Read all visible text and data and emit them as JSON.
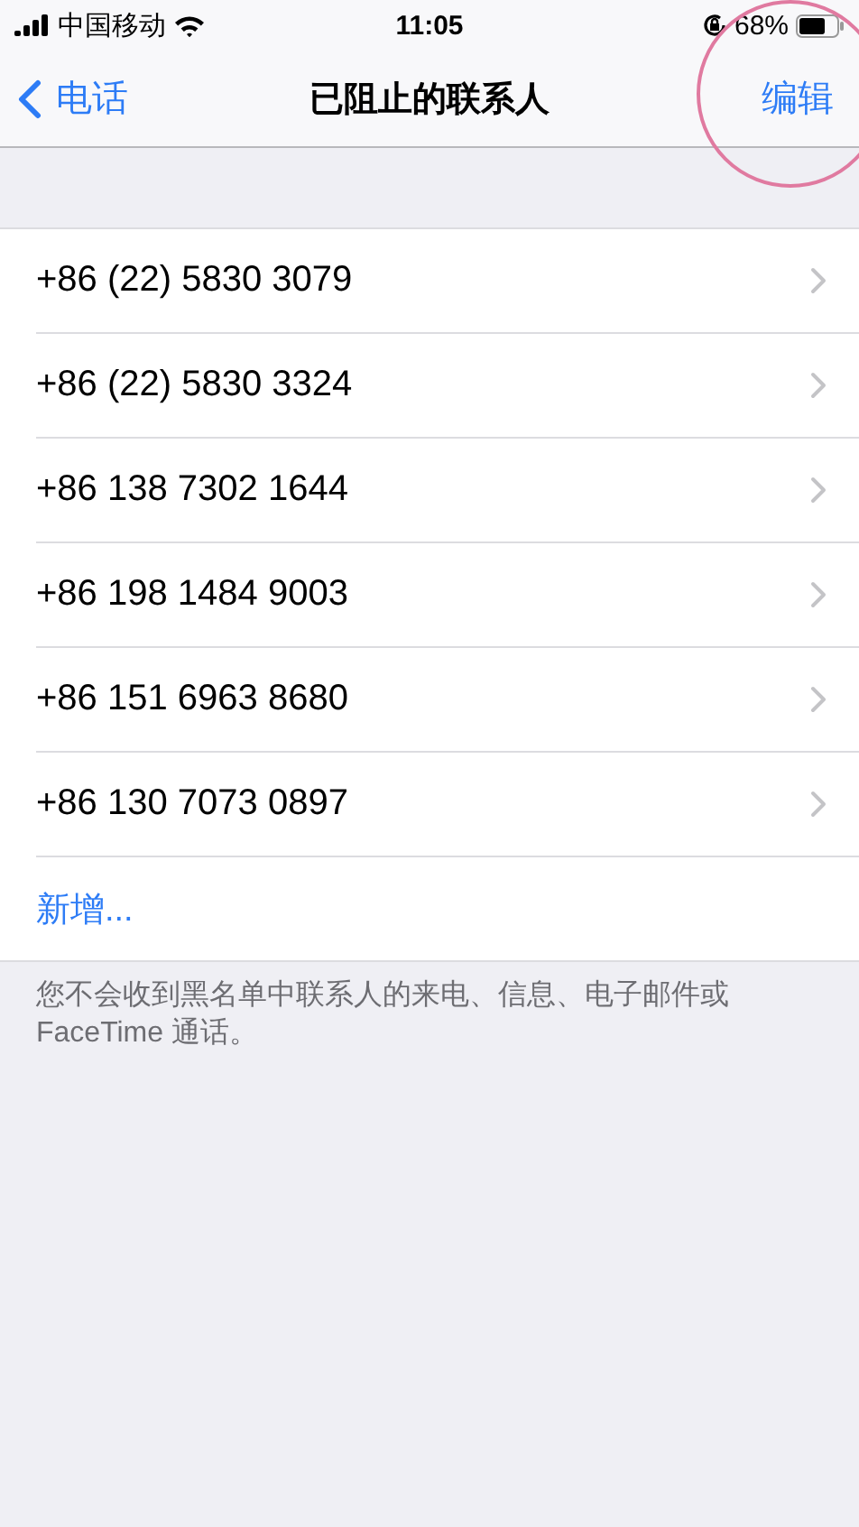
{
  "status_bar": {
    "carrier": "中国移动",
    "time": "11:05",
    "battery": "68%"
  },
  "nav": {
    "back": "电话",
    "title": "已阻止的联系人",
    "action": "编辑"
  },
  "contacts": [
    {
      "number": "+86 (22) 5830 3079"
    },
    {
      "number": "+86 (22) 5830 3324"
    },
    {
      "number": "+86 138 7302 1644"
    },
    {
      "number": "+86 198 1484 9003"
    },
    {
      "number": "+86 151 6963 8680"
    },
    {
      "number": "+86 130 7073 0897"
    }
  ],
  "add": "新增...",
  "footer": "您不会收到黑名单中联系人的来电、信息、电子邮件或FaceTime 通话。"
}
